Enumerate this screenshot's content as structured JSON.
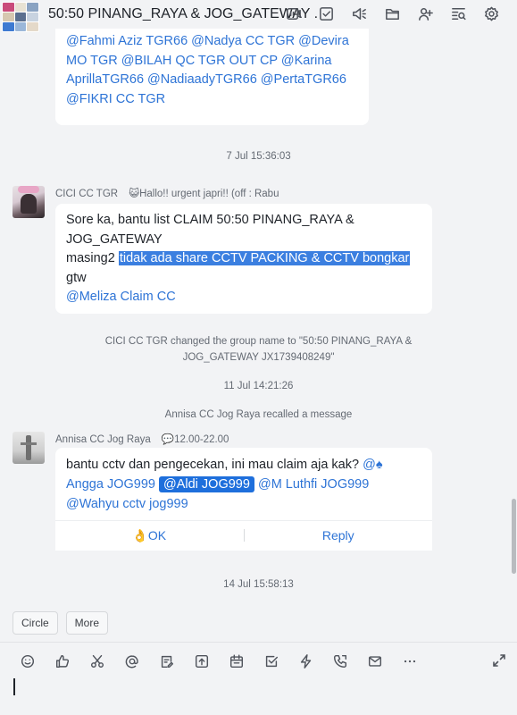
{
  "header": {
    "title": "50:50 PINANG_RAYA & JOG_GATEWAY .",
    "icons": [
      "video-icon",
      "task-check-icon",
      "announcement-icon",
      "folder-icon",
      "add-member-icon",
      "search-history-icon",
      "settings-icon"
    ]
  },
  "messages": {
    "m1_mentions": "@Fahmi Aziz TGR66 @Nadya CC TGR @Devira MO TGR @BILAH QC TGR OUT CP @Karina AprillaTGR66 @NadiaadyTGR66 @PertaTGR66 @FIKRI CC TGR",
    "ts1": "7 Jul 15:36:03",
    "m2_sender": "CICI CC TGR",
    "m2_status": "😺Hallo!! urgent japri!! (off : Rabu",
    "m2_line1": "Sore ka, bantu list  CLAIM 50:50 PINANG_RAYA & JOG_GATEWAY",
    "m2_line2a": "masing2 ",
    "m2_line2b": "tidak ada share CCTV PACKING & CCTV bongkar",
    "m2_line3": "gtw",
    "m2_mention": "@Meliza Claim CC",
    "sys1": "CICI CC TGR changed the group name to \"50:50 PINANG_RAYA & JOG_GATEWAY JX1739408249\"",
    "ts2": "11 Jul 14:21:26",
    "sys2": "Annisa CC Jog Raya recalled a message",
    "m3_sender": "Annisa CC Jog Raya",
    "m3_status": "💬12.00-22.00",
    "m3_text": "bantu cctv dan pengecekan, ini mau claim aja kak? ",
    "m3_m1": "@♠ Angga JOG999",
    "m3_m2": "@Aldi JOG999",
    "m3_m3": "@M Luthfi JOG999",
    "m3_m4": "@Wahyu cctv jog999",
    "action_ok": "👌OK",
    "action_reply": "Reply",
    "ts3": "14 Jul 15:58:13"
  },
  "quick_chips": [
    "Circle",
    "More"
  ],
  "composer": {
    "tools": [
      "emoji-icon",
      "thumbs-up-icon",
      "scissors-icon",
      "mention-icon",
      "edit-doc-icon",
      "upload-icon",
      "calendar-icon",
      "checkbox-icon",
      "lightning-icon",
      "phone-icon",
      "mail-icon",
      "more-icon"
    ]
  },
  "colors": {
    "accent": "#2e74d6",
    "highlight": "#3b7fe0",
    "background": "#f2f3f5"
  }
}
